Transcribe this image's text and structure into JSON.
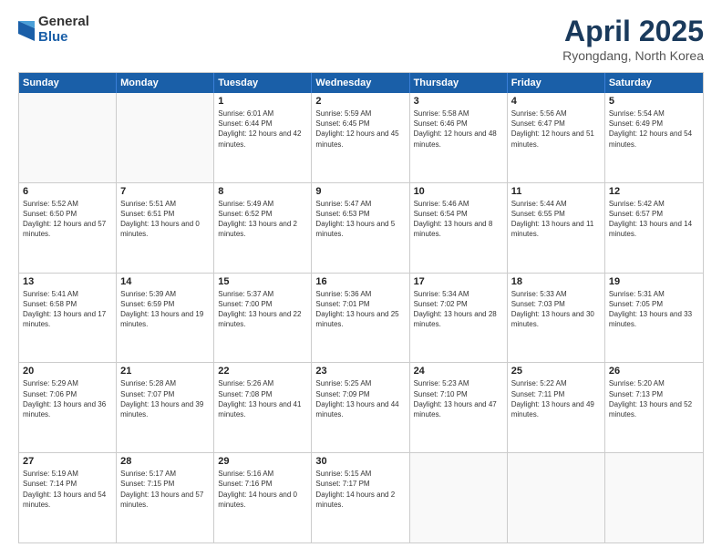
{
  "header": {
    "logo": {
      "general": "General",
      "blue": "Blue"
    },
    "title": "April 2025",
    "location": "Ryongdang, North Korea"
  },
  "weekdays": [
    "Sunday",
    "Monday",
    "Tuesday",
    "Wednesday",
    "Thursday",
    "Friday",
    "Saturday"
  ],
  "weeks": [
    [
      {
        "day": "",
        "empty": true
      },
      {
        "day": "",
        "empty": true
      },
      {
        "day": "1",
        "sunrise": "Sunrise: 6:01 AM",
        "sunset": "Sunset: 6:44 PM",
        "daylight": "Daylight: 12 hours and 42 minutes."
      },
      {
        "day": "2",
        "sunrise": "Sunrise: 5:59 AM",
        "sunset": "Sunset: 6:45 PM",
        "daylight": "Daylight: 12 hours and 45 minutes."
      },
      {
        "day": "3",
        "sunrise": "Sunrise: 5:58 AM",
        "sunset": "Sunset: 6:46 PM",
        "daylight": "Daylight: 12 hours and 48 minutes."
      },
      {
        "day": "4",
        "sunrise": "Sunrise: 5:56 AM",
        "sunset": "Sunset: 6:47 PM",
        "daylight": "Daylight: 12 hours and 51 minutes."
      },
      {
        "day": "5",
        "sunrise": "Sunrise: 5:54 AM",
        "sunset": "Sunset: 6:49 PM",
        "daylight": "Daylight: 12 hours and 54 minutes."
      }
    ],
    [
      {
        "day": "6",
        "sunrise": "Sunrise: 5:52 AM",
        "sunset": "Sunset: 6:50 PM",
        "daylight": "Daylight: 12 hours and 57 minutes."
      },
      {
        "day": "7",
        "sunrise": "Sunrise: 5:51 AM",
        "sunset": "Sunset: 6:51 PM",
        "daylight": "Daylight: 13 hours and 0 minutes."
      },
      {
        "day": "8",
        "sunrise": "Sunrise: 5:49 AM",
        "sunset": "Sunset: 6:52 PM",
        "daylight": "Daylight: 13 hours and 2 minutes."
      },
      {
        "day": "9",
        "sunrise": "Sunrise: 5:47 AM",
        "sunset": "Sunset: 6:53 PM",
        "daylight": "Daylight: 13 hours and 5 minutes."
      },
      {
        "day": "10",
        "sunrise": "Sunrise: 5:46 AM",
        "sunset": "Sunset: 6:54 PM",
        "daylight": "Daylight: 13 hours and 8 minutes."
      },
      {
        "day": "11",
        "sunrise": "Sunrise: 5:44 AM",
        "sunset": "Sunset: 6:55 PM",
        "daylight": "Daylight: 13 hours and 11 minutes."
      },
      {
        "day": "12",
        "sunrise": "Sunrise: 5:42 AM",
        "sunset": "Sunset: 6:57 PM",
        "daylight": "Daylight: 13 hours and 14 minutes."
      }
    ],
    [
      {
        "day": "13",
        "sunrise": "Sunrise: 5:41 AM",
        "sunset": "Sunset: 6:58 PM",
        "daylight": "Daylight: 13 hours and 17 minutes."
      },
      {
        "day": "14",
        "sunrise": "Sunrise: 5:39 AM",
        "sunset": "Sunset: 6:59 PM",
        "daylight": "Daylight: 13 hours and 19 minutes."
      },
      {
        "day": "15",
        "sunrise": "Sunrise: 5:37 AM",
        "sunset": "Sunset: 7:00 PM",
        "daylight": "Daylight: 13 hours and 22 minutes."
      },
      {
        "day": "16",
        "sunrise": "Sunrise: 5:36 AM",
        "sunset": "Sunset: 7:01 PM",
        "daylight": "Daylight: 13 hours and 25 minutes."
      },
      {
        "day": "17",
        "sunrise": "Sunrise: 5:34 AM",
        "sunset": "Sunset: 7:02 PM",
        "daylight": "Daylight: 13 hours and 28 minutes."
      },
      {
        "day": "18",
        "sunrise": "Sunrise: 5:33 AM",
        "sunset": "Sunset: 7:03 PM",
        "daylight": "Daylight: 13 hours and 30 minutes."
      },
      {
        "day": "19",
        "sunrise": "Sunrise: 5:31 AM",
        "sunset": "Sunset: 7:05 PM",
        "daylight": "Daylight: 13 hours and 33 minutes."
      }
    ],
    [
      {
        "day": "20",
        "sunrise": "Sunrise: 5:29 AM",
        "sunset": "Sunset: 7:06 PM",
        "daylight": "Daylight: 13 hours and 36 minutes."
      },
      {
        "day": "21",
        "sunrise": "Sunrise: 5:28 AM",
        "sunset": "Sunset: 7:07 PM",
        "daylight": "Daylight: 13 hours and 39 minutes."
      },
      {
        "day": "22",
        "sunrise": "Sunrise: 5:26 AM",
        "sunset": "Sunset: 7:08 PM",
        "daylight": "Daylight: 13 hours and 41 minutes."
      },
      {
        "day": "23",
        "sunrise": "Sunrise: 5:25 AM",
        "sunset": "Sunset: 7:09 PM",
        "daylight": "Daylight: 13 hours and 44 minutes."
      },
      {
        "day": "24",
        "sunrise": "Sunrise: 5:23 AM",
        "sunset": "Sunset: 7:10 PM",
        "daylight": "Daylight: 13 hours and 47 minutes."
      },
      {
        "day": "25",
        "sunrise": "Sunrise: 5:22 AM",
        "sunset": "Sunset: 7:11 PM",
        "daylight": "Daylight: 13 hours and 49 minutes."
      },
      {
        "day": "26",
        "sunrise": "Sunrise: 5:20 AM",
        "sunset": "Sunset: 7:13 PM",
        "daylight": "Daylight: 13 hours and 52 minutes."
      }
    ],
    [
      {
        "day": "27",
        "sunrise": "Sunrise: 5:19 AM",
        "sunset": "Sunset: 7:14 PM",
        "daylight": "Daylight: 13 hours and 54 minutes."
      },
      {
        "day": "28",
        "sunrise": "Sunrise: 5:17 AM",
        "sunset": "Sunset: 7:15 PM",
        "daylight": "Daylight: 13 hours and 57 minutes."
      },
      {
        "day": "29",
        "sunrise": "Sunrise: 5:16 AM",
        "sunset": "Sunset: 7:16 PM",
        "daylight": "Daylight: 14 hours and 0 minutes."
      },
      {
        "day": "30",
        "sunrise": "Sunrise: 5:15 AM",
        "sunset": "Sunset: 7:17 PM",
        "daylight": "Daylight: 14 hours and 2 minutes."
      },
      {
        "day": "",
        "empty": true
      },
      {
        "day": "",
        "empty": true
      },
      {
        "day": "",
        "empty": true
      }
    ]
  ]
}
